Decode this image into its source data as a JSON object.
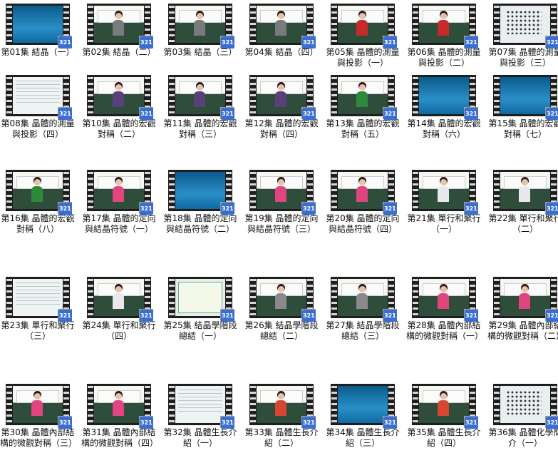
{
  "badge_text": "321",
  "videos": [
    {
      "caption": "第01集 結晶（一）",
      "scene": "blue"
    },
    {
      "caption": "第02集 結晶（二）",
      "scene": "class",
      "shirt": "#7a7a7a"
    },
    {
      "caption": "第03集 結晶（三）",
      "scene": "class",
      "shirt": "#7a7a7a"
    },
    {
      "caption": "第04集 結晶（四）",
      "scene": "class",
      "shirt": "#7a7a7a"
    },
    {
      "caption": "第05集 晶體的測量與投影（一）",
      "scene": "class",
      "shirt": "#c62a2a"
    },
    {
      "caption": "第06集 晶體的測量與投影（二）",
      "scene": "class",
      "shirt": "#c62a2a"
    },
    {
      "caption": "第07集 晶體的測量與投影（三）",
      "scene": "dots"
    },
    {
      "caption": "第08集 晶體的測量與投影（四）",
      "scene": "doc"
    },
    {
      "caption": "第10集 晶體的宏觀對稱（二）",
      "scene": "class",
      "shirt": "#5b3f78"
    },
    {
      "caption": "第11集 晶體的宏觀對稱（三）",
      "scene": "class",
      "shirt": "#5b3f78"
    },
    {
      "caption": "第12集 晶體的宏觀對稱（四）",
      "scene": "class",
      "shirt": "#5b3f78"
    },
    {
      "caption": "第13集 晶體的宏觀對稱（五）",
      "scene": "class",
      "shirt": "#2e8a3a"
    },
    {
      "caption": "第14集 晶體的宏觀對稱（六）",
      "scene": "blue"
    },
    {
      "caption": "第15集 晶體的宏觀對稱（七）",
      "scene": "blue"
    },
    {
      "caption": "第16集 晶體的宏觀對稱（八）",
      "scene": "class",
      "shirt": "#2e8a3a"
    },
    {
      "caption": "第17集 晶體的定向與結晶符號（一）",
      "scene": "class",
      "shirt": "#e0457f"
    },
    {
      "caption": "第18集 晶體的定向與結晶符號（二）",
      "scene": "blue"
    },
    {
      "caption": "第19集 晶體的定向與結晶符號（三）",
      "scene": "class",
      "shirt": "#e0457f"
    },
    {
      "caption": "第20集 晶體的定向與結晶符號（四）",
      "scene": "class",
      "shirt": "#e0457f"
    },
    {
      "caption": "第21集 單行和聚行（一）",
      "scene": "class",
      "shirt": "#e8e8e8"
    },
    {
      "caption": "第22集 單行和聚行（二）",
      "scene": "class",
      "shirt": "#e8e8e8"
    },
    {
      "caption": "第23集 單行和聚行（三）",
      "scene": "doc"
    },
    {
      "caption": "第24集 單行和聚行（四）",
      "scene": "class",
      "shirt": "#e8e8e8"
    },
    {
      "caption": "第25集 結晶學階段總結（一）",
      "scene": "slide"
    },
    {
      "caption": "第26集 結晶學階段總結（二）",
      "scene": "class",
      "shirt": "#8a8a8a"
    },
    {
      "caption": "第27集 結晶學階段總結（三）",
      "scene": "class",
      "shirt": "#8a8a8a"
    },
    {
      "caption": "第28集 晶體內部結構的微觀對稱（一）",
      "scene": "class",
      "shirt": "#e0457f"
    },
    {
      "caption": "第29集 晶體內部結構的微觀對稱（二）",
      "scene": "class",
      "shirt": "#e0457f"
    },
    {
      "caption": "第30集 晶體內部結構的微觀對稱（三）",
      "scene": "class",
      "shirt": "#e0457f"
    },
    {
      "caption": "第31集 晶體內部結構的微觀對稱（四）",
      "scene": "class",
      "shirt": "#e0457f"
    },
    {
      "caption": "第32集 晶體生長介紹（一）",
      "scene": "doc"
    },
    {
      "caption": "第33集 晶體生長介紹（二）",
      "scene": "class",
      "shirt": "#d9462f"
    },
    {
      "caption": "第34集 晶體生長介紹（三）",
      "scene": "blue"
    },
    {
      "caption": "第35集 晶體生長介紹（四）",
      "scene": "class",
      "shirt": "#d9462f"
    },
    {
      "caption": "第36集 晶體化學簡介（一）",
      "scene": "dots"
    }
  ]
}
